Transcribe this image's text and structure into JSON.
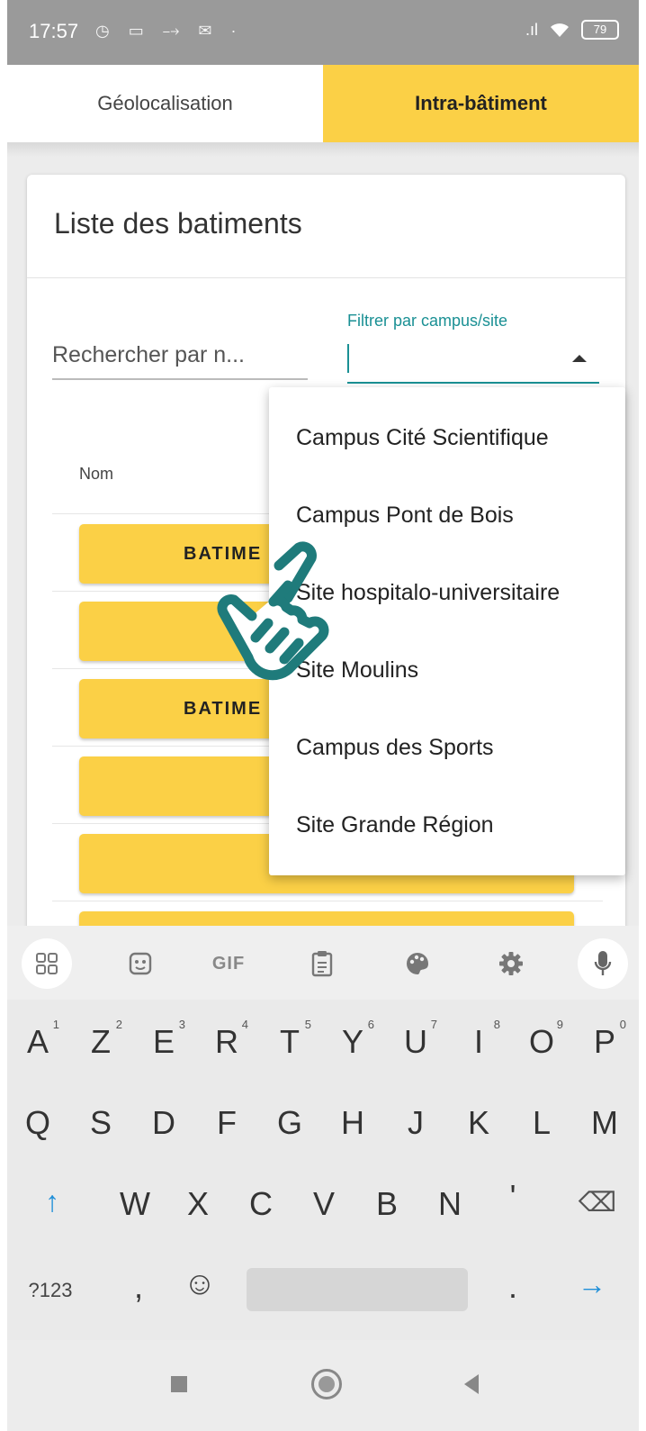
{
  "status_bar": {
    "time": "17:57",
    "left_icons": "◷ ▭ ⤍ ✉ ·",
    "signal": ".ıl",
    "wifi": "wifi-icon",
    "battery": "79"
  },
  "tabs": [
    {
      "label": "Géolocalisation",
      "active": false
    },
    {
      "label": "Intra-bâtiment",
      "active": true
    }
  ],
  "card": {
    "title": "Liste des batiments",
    "search_placeholder": "Rechercher par n...",
    "filter_label": "Filtrer par campus/site",
    "column_header": "Nom",
    "rows": [
      {
        "label": "BATIME"
      },
      {
        "label": ""
      },
      {
        "label": "BATIME"
      },
      {
        "label": ""
      },
      {
        "label": ""
      },
      {
        "label": ""
      }
    ]
  },
  "dropdown": {
    "options": [
      "Campus Cité Scientifique",
      "Campus Pont de Bois",
      "Site hospitalo-universitaire",
      "Site Moulins",
      "Campus des Sports",
      "Site Grande Région"
    ]
  },
  "keyboard": {
    "toolbar": [
      "grid-icon",
      "sticker-icon",
      "GIF",
      "clipboard-icon",
      "palette-icon",
      "gear-icon",
      "mic-icon"
    ],
    "gif_label": "GIF",
    "row1": [
      "A",
      "Z",
      "E",
      "R",
      "T",
      "Y",
      "U",
      "I",
      "O",
      "P"
    ],
    "row1_hints": [
      "1",
      "2",
      "3",
      "4",
      "5",
      "6",
      "7",
      "8",
      "9",
      "0"
    ],
    "row2": [
      "Q",
      "S",
      "D",
      "F",
      "G",
      "H",
      "J",
      "K",
      "L",
      "M"
    ],
    "row3": [
      "W",
      "X",
      "C",
      "V",
      "B",
      "N",
      "'"
    ],
    "shift": "↑",
    "backspace": "⌫",
    "symbols": "?123",
    "comma": ",",
    "emoji": "☺",
    "period": ".",
    "enter": "→"
  },
  "colors": {
    "accent_yellow": "#fbd046",
    "teal": "#1a9094"
  }
}
